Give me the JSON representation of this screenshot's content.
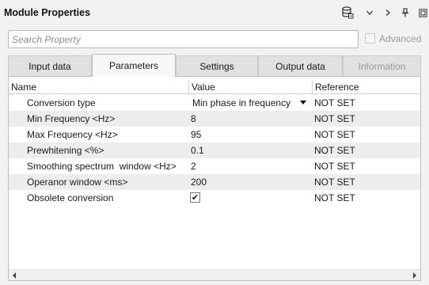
{
  "window": {
    "title": "Module Properties"
  },
  "toolbar": {
    "icons": [
      "database-icon",
      "chevron-down-icon",
      "chevron-right-icon",
      "pin-icon",
      "restore-window-icon"
    ]
  },
  "search": {
    "placeholder": "Search Property",
    "value": ""
  },
  "advanced": {
    "label": "Advanced",
    "checked": false
  },
  "tabs": [
    {
      "label": "Input data",
      "active": false,
      "disabled": false
    },
    {
      "label": "Parameters",
      "active": true,
      "disabled": false
    },
    {
      "label": "Settings",
      "active": false,
      "disabled": false
    },
    {
      "label": "Output data",
      "active": false,
      "disabled": false
    },
    {
      "label": "Information",
      "active": false,
      "disabled": true
    }
  ],
  "table": {
    "columns": [
      "Name",
      "Value",
      "Reference"
    ],
    "rows": [
      {
        "name": "Conversion type",
        "value": "Min phase in frequency",
        "reference": "NOT SET",
        "kind": "dropdown"
      },
      {
        "name": "Min Frequency <Hz>",
        "value": "8",
        "reference": "NOT SET",
        "kind": "text"
      },
      {
        "name": "Max Frequency <Hz>",
        "value": "95",
        "reference": "NOT SET",
        "kind": "text"
      },
      {
        "name": "Prewhitening <%>",
        "value": "0.1",
        "reference": "NOT SET",
        "kind": "text"
      },
      {
        "name": "Smoothing spectrum  window <Hz>",
        "value": "2",
        "reference": "NOT SET",
        "kind": "text"
      },
      {
        "name": "Operanor window <ms>",
        "value": "200",
        "reference": "NOT SET",
        "kind": "text"
      },
      {
        "name": "Obsolete conversion",
        "value": "✔",
        "reference": "NOT SET",
        "kind": "checkbox",
        "checked": true
      }
    ]
  },
  "colors": {
    "background": "#f2f2f2",
    "panel": "#ffffff",
    "alt_row": "#ededed",
    "tab_inactive": "#e1e1e1",
    "tab_active": "#f7f7f7",
    "disabled_text": "#9a9a9a"
  }
}
